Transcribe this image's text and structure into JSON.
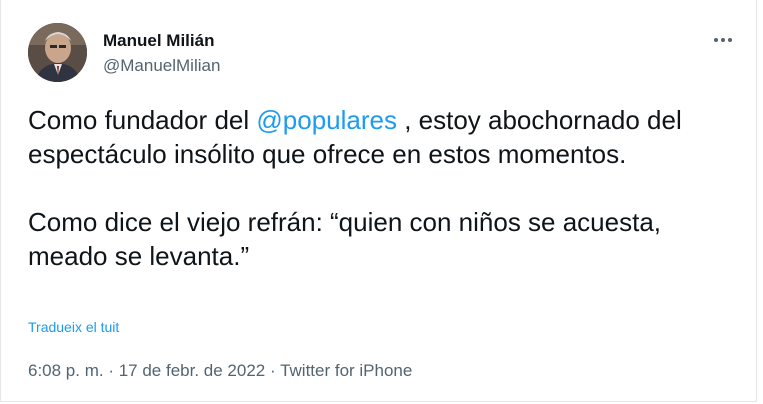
{
  "author": {
    "name": "Manuel Milián",
    "handle": "@ManuelMilian"
  },
  "tweet": {
    "line1_before": "Como fundador del ",
    "mention": "@populares",
    "line1_after": " , estoy abochornado del espectáculo insólito que ofrece en estos momentos.",
    "paragraph2": "Como dice el viejo refrán: “quien con niños se acuesta, meado se levanta.”"
  },
  "translate_label": "Tradueix el tuit",
  "meta": {
    "time": "6:08 p. m.",
    "separator": " · ",
    "date": "17 de febr. de 2022",
    "source": "Twitter for iPhone"
  },
  "colors": {
    "link": "#1d9bf0",
    "secondary_text": "#536471",
    "primary_text": "#0f1419"
  },
  "icons": {
    "more": "more-horizontal-icon"
  }
}
